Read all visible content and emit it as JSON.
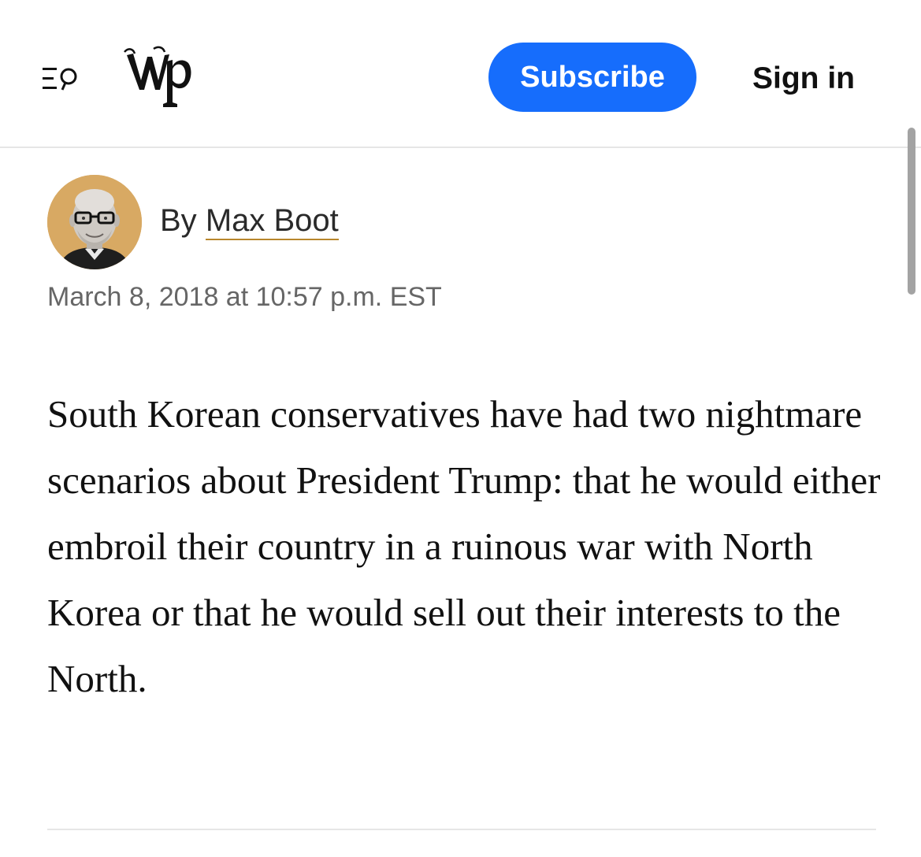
{
  "header": {
    "logo_text": "wp",
    "subscribe_label": "Subscribe",
    "signin_label": "Sign in"
  },
  "article": {
    "byline_prefix": "By",
    "author_name": "Max Boot",
    "timestamp": "March 8, 2018 at 10:57 p.m. EST",
    "lede": "South Korean conservatives have had two nightmare scenarios about President Trump: that he would either embroil their country in a ruinous war with North Korea or that he would sell out their interests to the North."
  },
  "colors": {
    "accent": "#166dfc",
    "avatar_bg": "#d8a963",
    "author_underline": "#b8862d"
  },
  "icons": {
    "menu": "menu-search-icon",
    "logo": "washington-post-logo"
  }
}
